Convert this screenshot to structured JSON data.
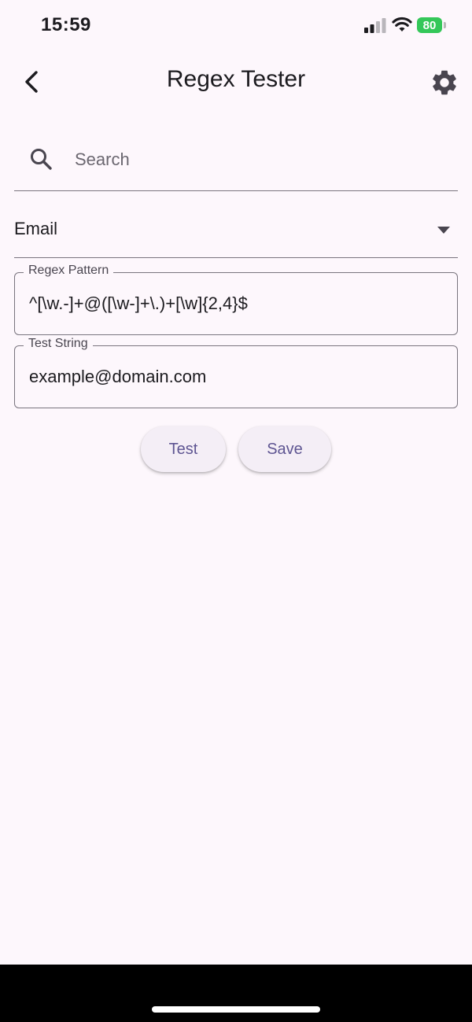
{
  "status_bar": {
    "time": "15:59",
    "battery_level": "80"
  },
  "app_bar": {
    "title": "Regex Tester",
    "back_icon": "chevron-left-icon",
    "settings_icon": "gear-icon"
  },
  "search": {
    "placeholder": "Search",
    "value": "",
    "icon": "search-icon"
  },
  "category_dropdown": {
    "selected": "Email"
  },
  "regex_field": {
    "label": "Regex Pattern",
    "value": "^[\\w.-]+@([\\w-]+\\.)+[\\w]{2,4}$"
  },
  "test_field": {
    "label": "Test String",
    "value": "example@domain.com"
  },
  "actions": {
    "test_label": "Test",
    "save_label": "Save"
  },
  "colors": {
    "background": "#fdf7fc",
    "button_text": "#5e5592",
    "battery": "#34c759",
    "outline": "#79747e"
  }
}
